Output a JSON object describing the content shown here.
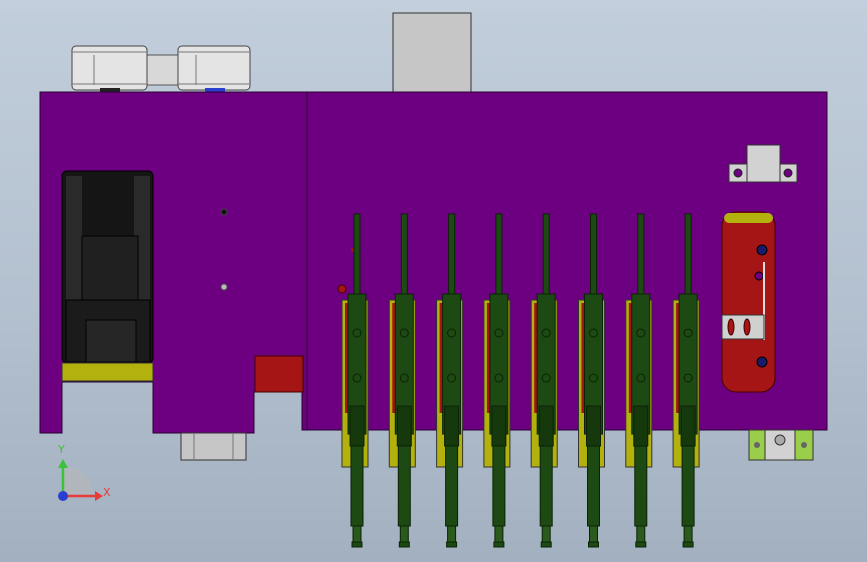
{
  "viewport": {
    "axes": {
      "x_label": "X",
      "y_label": "Y",
      "x_color": "#e83a3a",
      "y_color": "#39c23a",
      "z_color": "#2a3ed0"
    }
  },
  "colors": {
    "background": "#b9c5d3",
    "body": "#6c0080",
    "edge": "#2a0033",
    "motor": "#151515",
    "olive": "#b3b10e",
    "nozzle": "#1d4a12",
    "bracket": "#a51515",
    "gray_part": "#c6c6c6",
    "green_bracket": "#9acd4a"
  },
  "icons": {
    "triad": "coordinate-triad-icon"
  },
  "model": {
    "nozzle_count": 8
  }
}
